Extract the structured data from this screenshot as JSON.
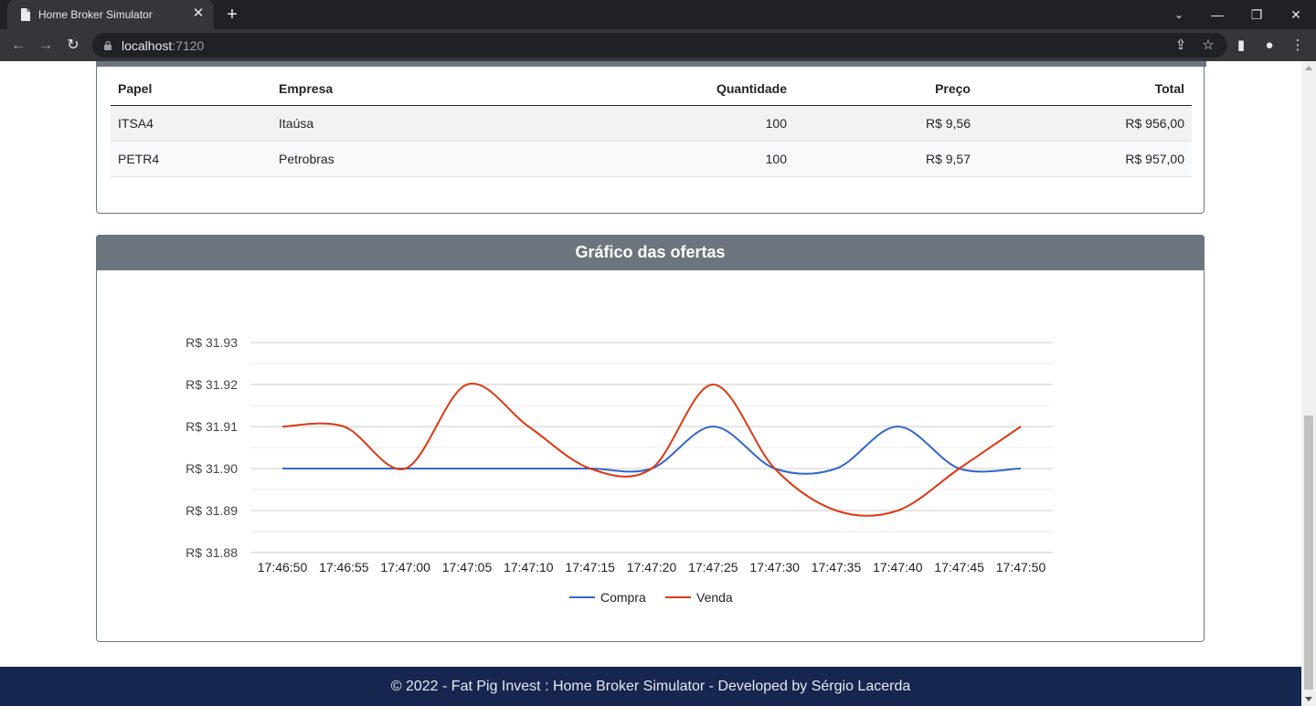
{
  "browser": {
    "tab_title": "Home Broker Simulator",
    "url_host": "localhost",
    "url_port": ":7120"
  },
  "orders_table": {
    "columns": [
      "Papel",
      "Empresa",
      "Quantidade",
      "Preço",
      "Total"
    ],
    "rows": [
      [
        "ITSA4",
        "Itaúsa",
        "100",
        "R$ 9,56",
        "R$ 956,00"
      ],
      [
        "PETR4",
        "Petrobras",
        "100",
        "R$ 9,57",
        "R$ 957,00"
      ]
    ]
  },
  "chart_section": {
    "title": "Gráfico das ofertas"
  },
  "chart_data": {
    "type": "line",
    "title": "",
    "xlabel": "",
    "ylabel": "",
    "categories": [
      "17:46:50",
      "17:46:55",
      "17:47:00",
      "17:47:05",
      "17:47:10",
      "17:47:15",
      "17:47:20",
      "17:47:25",
      "17:47:30",
      "17:47:35",
      "17:47:40",
      "17:47:45",
      "17:47:50"
    ],
    "y_ticks": [
      "R$ 31.93",
      "R$ 31.92",
      "R$ 31.91",
      "R$ 31.90",
      "R$ 31.89",
      "R$ 31.88"
    ],
    "ylim": [
      31.88,
      31.93
    ],
    "grid": true,
    "smooth": true,
    "legend_position": "bottom",
    "series": [
      {
        "name": "Compra",
        "color": "#3366cc",
        "values": [
          31.9,
          31.9,
          31.9,
          31.9,
          31.9,
          31.9,
          31.9,
          31.91,
          31.9,
          31.9,
          31.91,
          31.9,
          31.9
        ]
      },
      {
        "name": "Venda",
        "color": "#dc3912",
        "values": [
          31.91,
          31.91,
          31.9,
          31.92,
          31.91,
          31.9,
          31.9,
          31.92,
          31.9,
          31.89,
          31.89,
          31.9,
          31.91
        ]
      }
    ]
  },
  "footer": {
    "text": "© 2022 - Fat Pig Invest : Home Broker Simulator - Developed by Sérgio Lacerda"
  }
}
